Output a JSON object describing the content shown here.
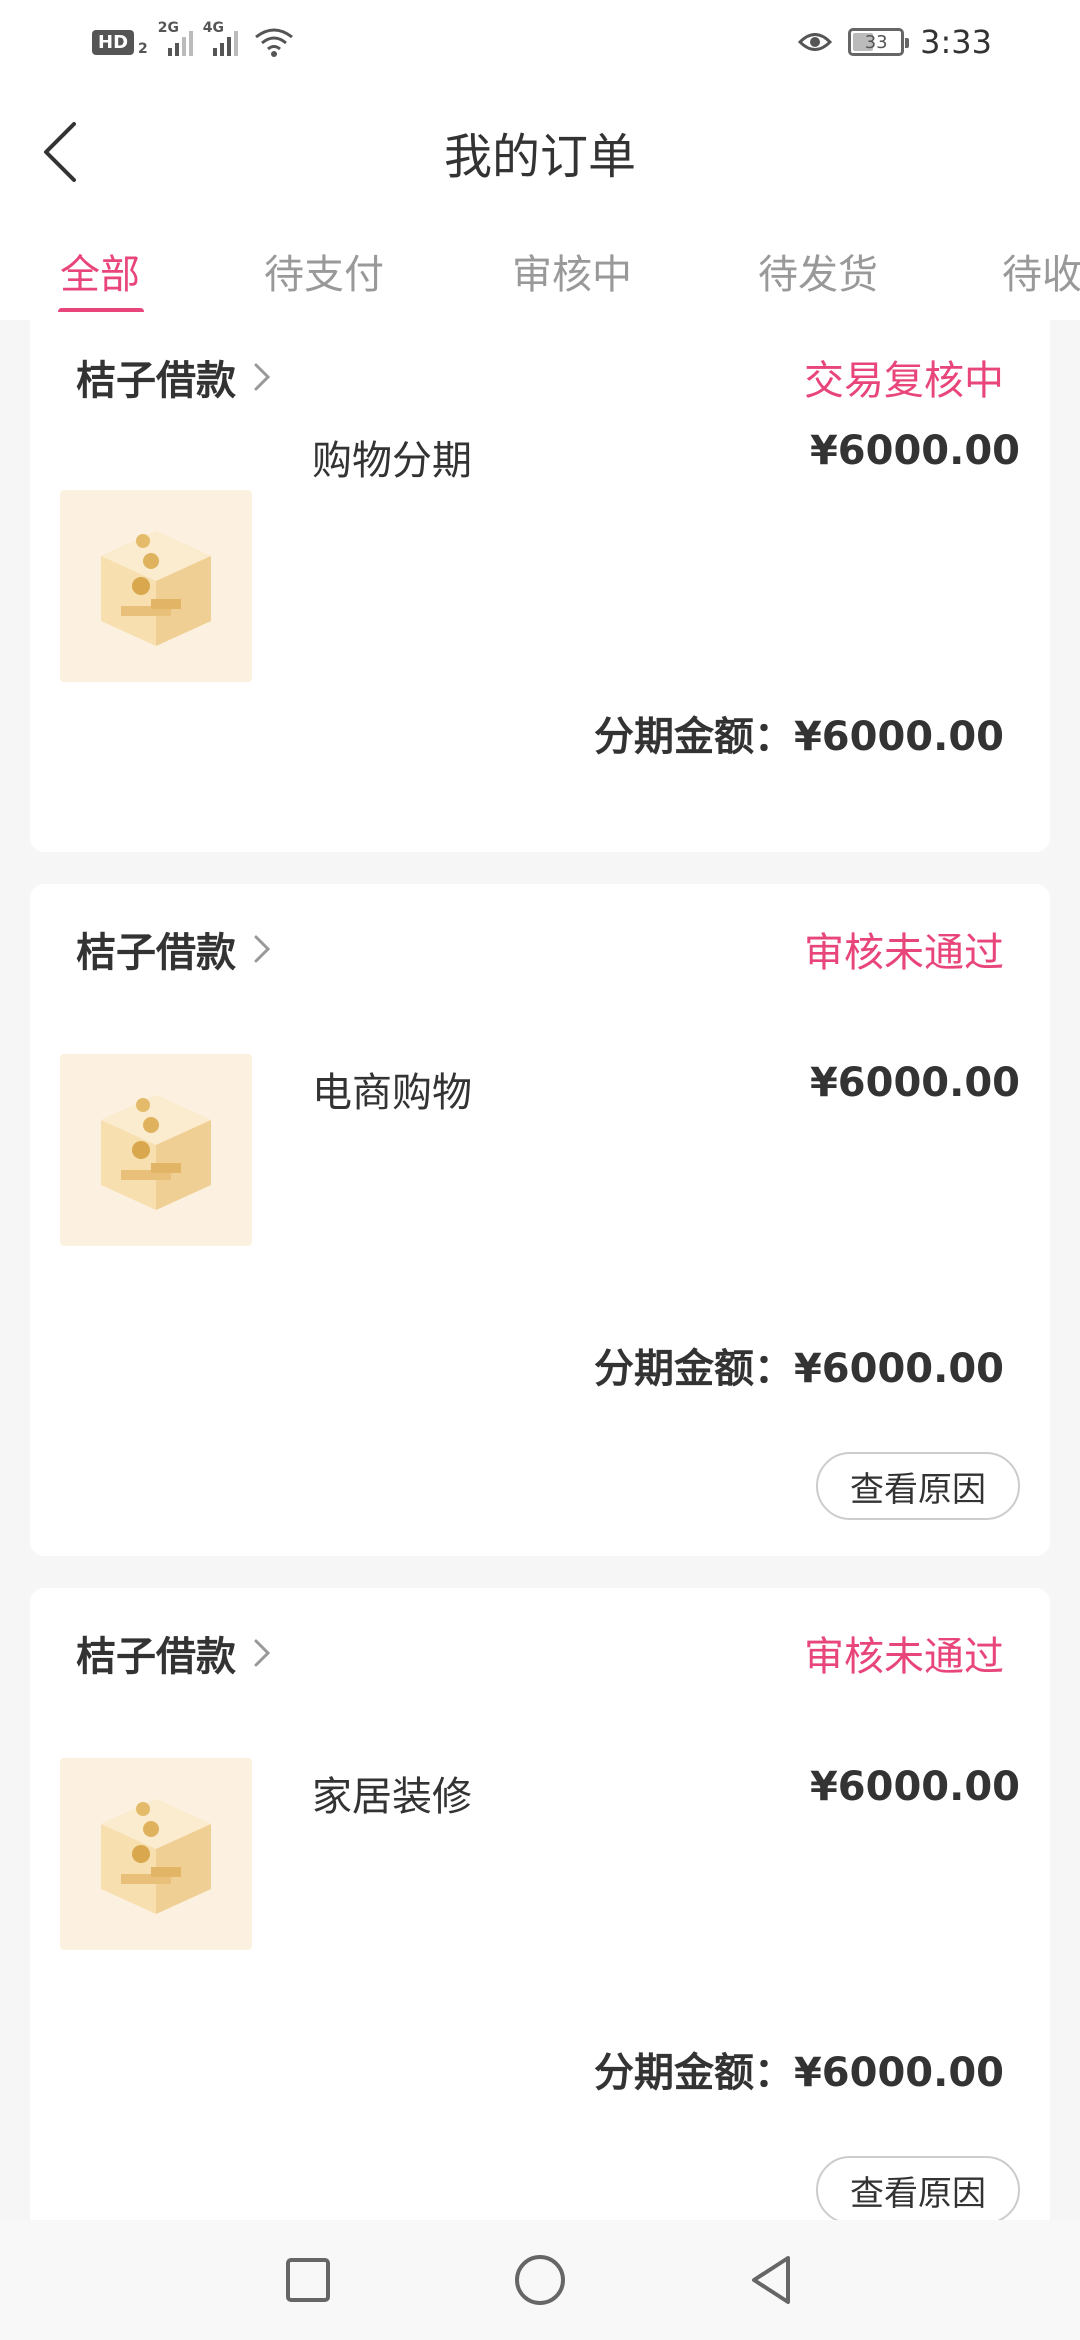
{
  "status_bar": {
    "hd": "HD",
    "hd_sub": "2",
    "sig1": "2G",
    "sig2": "4G",
    "battery": "33",
    "time": "3:33"
  },
  "header": {
    "title": "我的订单"
  },
  "tabs": [
    {
      "label": "全部",
      "active": true
    },
    {
      "label": "待支付"
    },
    {
      "label": "审核中"
    },
    {
      "label": "待发货"
    },
    {
      "label": "待收"
    }
  ],
  "orders": [
    {
      "merchant": "桔子借款",
      "status": "交易复核中",
      "product": "购物分期",
      "price": "¥6000.00",
      "installment_label": "分期金额：",
      "installment": "¥6000.00"
    },
    {
      "merchant": "桔子借款",
      "status": "审核未通过",
      "product": "电商购物",
      "price": "¥6000.00",
      "installment_label": "分期金额：",
      "installment": "¥6000.00",
      "button": "查看原因"
    },
    {
      "merchant": "桔子借款",
      "status": "审核未通过",
      "product": "家居装修",
      "price": "¥6000.00",
      "installment_label": "分期金额：",
      "installment": "¥6000.00",
      "button": "查看原因"
    }
  ],
  "colors": {
    "accent": "#e8457a",
    "background": "#f6f6f6"
  }
}
